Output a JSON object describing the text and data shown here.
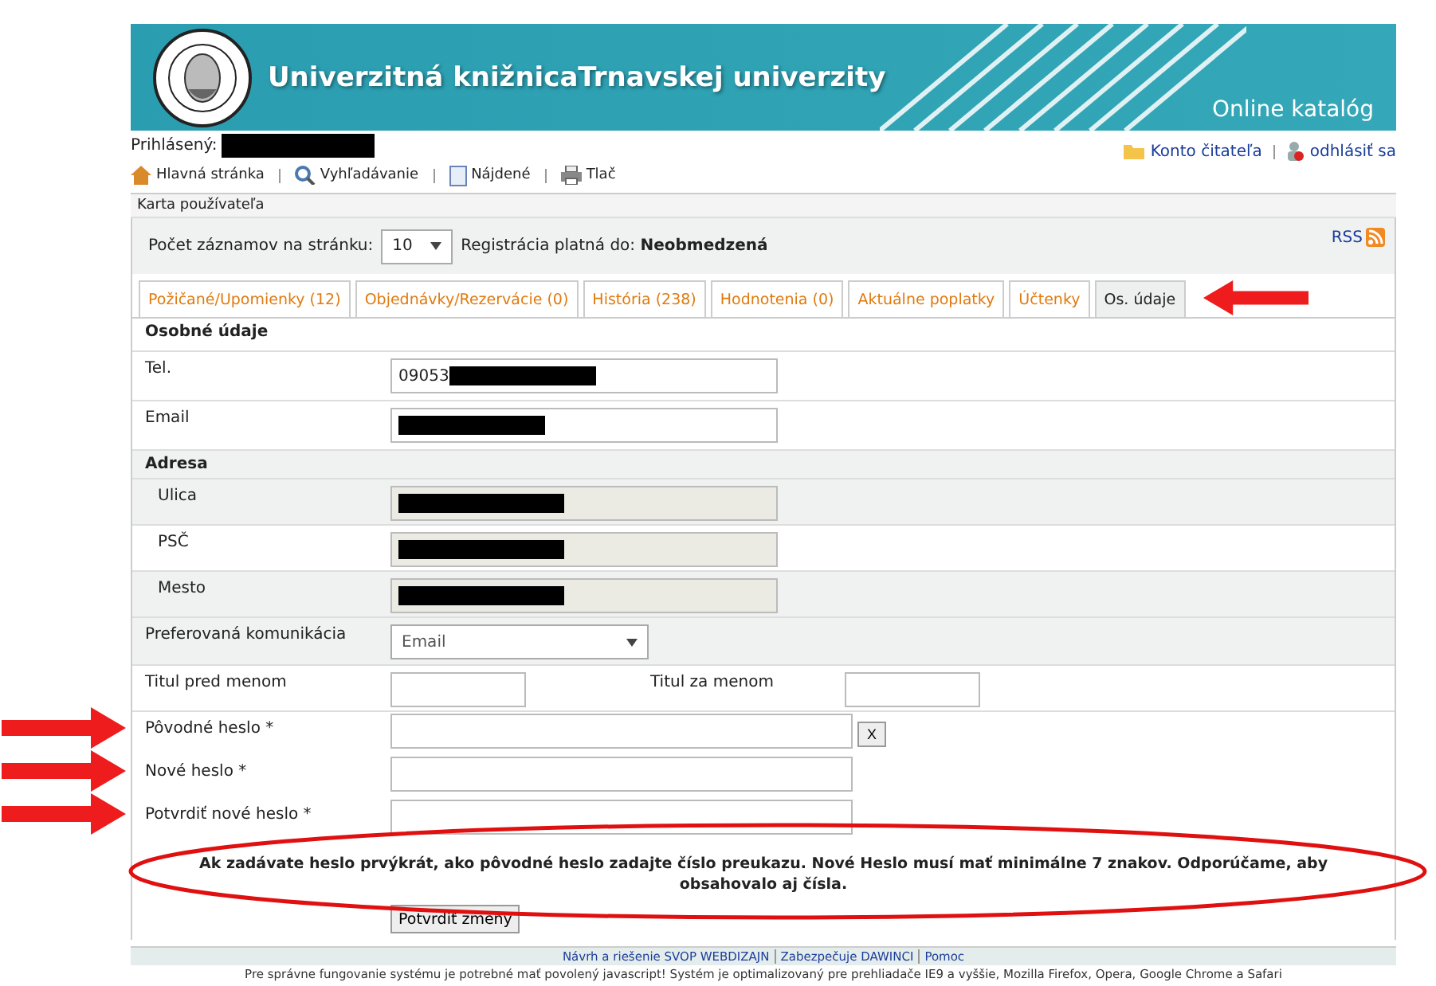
{
  "header": {
    "title": "Univerzitná knižnicaTrnavskej univerzity",
    "subtitle": "Online katalóg"
  },
  "user": {
    "label": "Prihlásený:",
    "redacted": true
  },
  "account_links": [
    "Konto čitateľa",
    "odhlásiť sa"
  ],
  "nav": [
    "Hlavná stránka",
    "Vyhľadávanie",
    "Nájdené",
    "Tlač"
  ],
  "section_title": "Karta používateľa",
  "records": {
    "label": "Počet záznamov na stránku:",
    "value": "10",
    "registration_label": "Registrácia platná do:",
    "registration_value": "Neobmedzená",
    "rss": "RSS"
  },
  "tabs": [
    {
      "label": "Požičané/Upomienky (12)",
      "selected": false
    },
    {
      "label": "Objednávky/Rezervácie (0)",
      "selected": false
    },
    {
      "label": "História (238)",
      "selected": false
    },
    {
      "label": "Hodnotenia (0)",
      "selected": false
    },
    {
      "label": "Aktuálne poplatky",
      "selected": false
    },
    {
      "label": "Účtenky",
      "selected": false
    },
    {
      "label": "Os. údaje",
      "selected": true
    }
  ],
  "form": {
    "heading": "Osobné údaje",
    "rows": [
      {
        "kind": "text",
        "label": "Tel.",
        "value": "09053",
        "redacted": true
      },
      {
        "kind": "text",
        "label": "Email",
        "redacted": true
      },
      {
        "kind": "section",
        "label": "Adresa"
      },
      {
        "kind": "readonly",
        "label": "Ulica",
        "redacted": true
      },
      {
        "kind": "readonly",
        "label": "PSČ",
        "redacted": true
      },
      {
        "kind": "readonly",
        "label": "Mesto",
        "redacted": true
      },
      {
        "kind": "select",
        "label": "Preferovaná komunikácia",
        "value": "Email"
      },
      {
        "kind": "pair",
        "label": "Titul pred menom",
        "label2": "Titul za menom"
      },
      {
        "kind": "password",
        "label": "Pôvodné heslo *",
        "clear": "X"
      },
      {
        "kind": "password",
        "label": "Nové heslo *"
      },
      {
        "kind": "password",
        "label": "Potvrdiť nové heslo *"
      }
    ],
    "note": "Ak zadávate heslo prvýkrát, ako pôvodné heslo zadajte číslo preukazu. Nové Heslo musí mať minimálne 7 znakov. Odporúčame, aby obsahovalo aj čísla.",
    "submit": "Potvrdiť zmeny"
  },
  "footer": {
    "links": [
      "Návrh a riešenie SVOP WEBDIZAJN",
      "Zabezpečuje DAWINCI",
      "Pomoc"
    ],
    "note": "Pre správne fungovanie systému je potrebné mať povolený javascript! Systém je optimalizovaný pre prehliadače IE9 a vyššie, Mozilla Firefox, Opera, Google Chrome a Safari"
  }
}
